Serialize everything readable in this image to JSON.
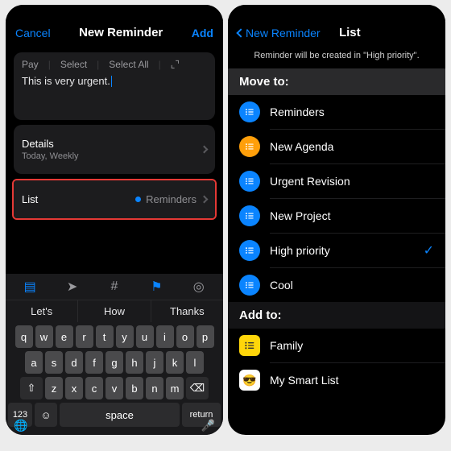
{
  "left": {
    "nav": {
      "cancel": "Cancel",
      "title": "New Reminder",
      "add": "Add"
    },
    "editbar": {
      "field": "Pay",
      "select": "Select",
      "selectAll": "Select All"
    },
    "notes": "This is very urgent.",
    "details": {
      "label": "Details",
      "sub": "Today, Weekly"
    },
    "listRow": {
      "label": "List",
      "value": "Reminders"
    },
    "suggestions": [
      "Let's",
      "How",
      "Thanks"
    ],
    "keyboard": {
      "row1": [
        "q",
        "w",
        "e",
        "r",
        "t",
        "y",
        "u",
        "i",
        "o",
        "p"
      ],
      "row2": [
        "a",
        "s",
        "d",
        "f",
        "g",
        "h",
        "j",
        "k",
        "l"
      ],
      "row3": [
        "z",
        "x",
        "c",
        "v",
        "b",
        "n",
        "m"
      ],
      "n123": "123",
      "space": "space",
      "return": "return"
    }
  },
  "right": {
    "nav": {
      "back": "New Reminder",
      "title": "List"
    },
    "hint": "Reminder will be created in \"High priority\".",
    "moveHeader": "Move to:",
    "lists": [
      {
        "name": "Reminders",
        "color": "#0a84ff",
        "selected": false
      },
      {
        "name": "New Agenda",
        "color": "#ff9f0a",
        "selected": false
      },
      {
        "name": "Urgent Revision",
        "color": "#0a84ff",
        "selected": false
      },
      {
        "name": "New Project",
        "color": "#0a84ff",
        "selected": false
      },
      {
        "name": "High priority",
        "color": "#0a84ff",
        "selected": true
      },
      {
        "name": "Cool",
        "color": "#0a84ff",
        "selected": false
      }
    ],
    "addHeader": "Add to:",
    "addLists": [
      {
        "name": "Family",
        "color": "#ffd60a",
        "emoji": ""
      },
      {
        "name": "My Smart List",
        "color": "#ffffff",
        "emoji": "😎"
      }
    ]
  }
}
